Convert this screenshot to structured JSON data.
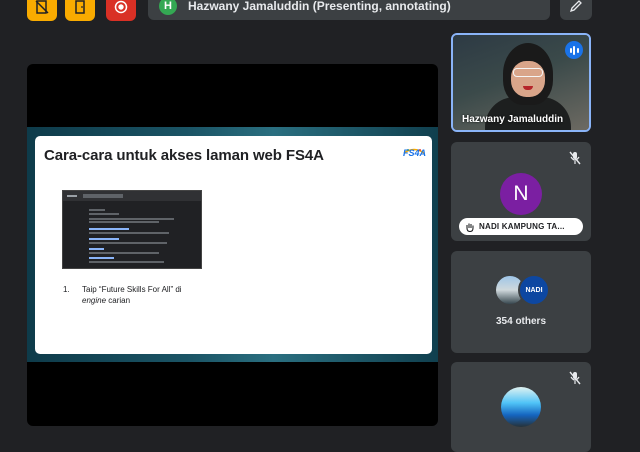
{
  "toolbar": {
    "icons": [
      "doc-off-icon",
      "door-icon",
      "record-icon",
      "pen-icon"
    ]
  },
  "presenter": {
    "avatar_letter": "H",
    "label": "Hazwany Jamaluddin (Presenting, annotating)"
  },
  "slide": {
    "title": "Cara-cara untuk akses laman web FS4A",
    "logo_text": "FS4A",
    "steps": [
      {
        "num": "1.",
        "text": "Taip “Future Skills For All” di",
        "emphasis": "engine",
        "suffix": " carian"
      }
    ]
  },
  "participants": {
    "active": {
      "name": "Hazwany Jamaluddin"
    },
    "n_tile": {
      "letter": "N",
      "name": "NADI KAMPUNG TA..."
    },
    "others": {
      "badge": "NADI",
      "count_label": "354 others"
    }
  },
  "colors": {
    "accent": "#8ab4f8",
    "avatar_n": "#7b1fa2",
    "presenter_avatar": "#34a853",
    "record": "#d93025",
    "toolbar_yellow": "#f9ab00"
  }
}
